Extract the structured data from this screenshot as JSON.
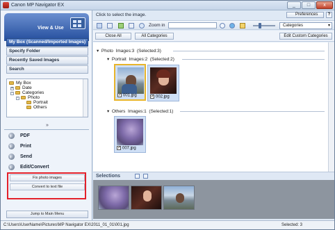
{
  "window": {
    "title": "Canon MP Navigator EX",
    "minimize": "_",
    "maximize": "□",
    "close": "x"
  },
  "colors": {
    "accent": "#2b55a1",
    "highlight_box": "#e3202a",
    "focus_border": "#e8b52b"
  },
  "sidebar": {
    "mode_label": "View & Use",
    "nav": [
      {
        "label": "My Box (Scanned/Imported Images)",
        "selected": true
      },
      {
        "label": "Specify Folder",
        "selected": false
      },
      {
        "label": "Recently Saved Images",
        "selected": false
      },
      {
        "label": "Search",
        "selected": false
      }
    ],
    "tree": [
      "My Box",
      "Date",
      "Categories",
      "Photo",
      "Portrait",
      "Others"
    ],
    "collapse_glyph": "»",
    "actions": [
      "PDF",
      "Print",
      "Send",
      "Edit/Convert"
    ],
    "edit_convert_items": [
      "Fix photo images",
      "Convert to text file"
    ],
    "jump_label": "Jump to Main Menu"
  },
  "top": {
    "hint": "Click to select the image.",
    "preferences_label": "Preferences",
    "help_label": "?",
    "zoom_label": "Zoom in",
    "search_value": "",
    "category_selected": "Categories",
    "close_all_label": "Close All",
    "all_categories_label": "All Categories",
    "edit_categories_label": "Edit Custom Categories"
  },
  "groups": {
    "photo": {
      "name": "Photo",
      "images": "Images:3",
      "selected": "(Selected:3)"
    },
    "portrait": {
      "name": "Portrait",
      "images": "Images:2",
      "selected": "(Selected:2)"
    },
    "others": {
      "name": "Others",
      "images": "Images:1",
      "selected": "(Selected:1)"
    }
  },
  "thumbnails": [
    {
      "file": "001.jpg",
      "checked": "✓"
    },
    {
      "file": "002.jpg",
      "checked": "✓"
    },
    {
      "file": "007.jpg",
      "checked": "✓"
    }
  ],
  "selections": {
    "label": "Selections"
  },
  "status": {
    "path": "C:\\Users\\UserName\\Pictures\\MP Navigator EX\\2011_01_01\\001.jpg",
    "count": "Selected: 3"
  }
}
